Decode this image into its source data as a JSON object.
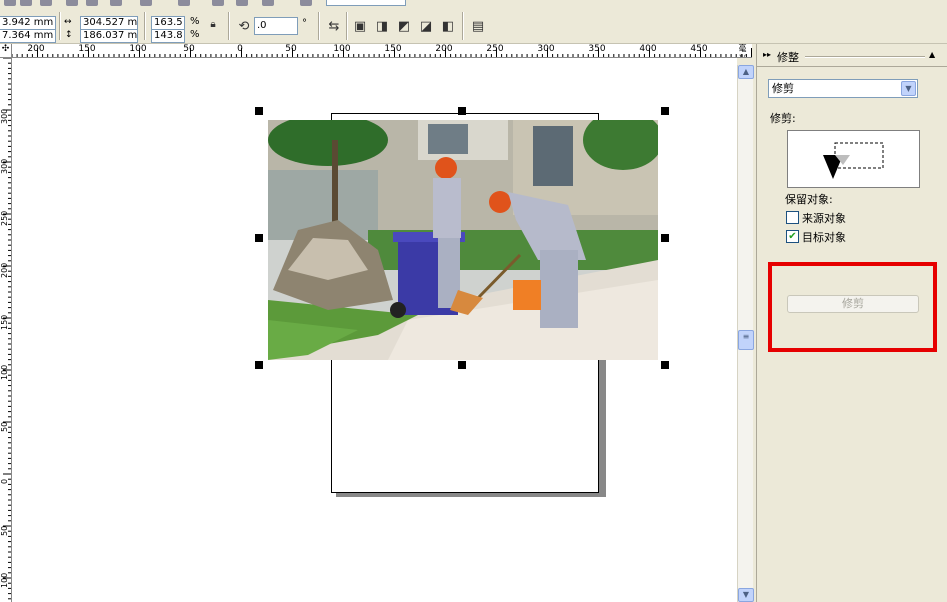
{
  "propertybar": {
    "pos_x": "3.942 mm",
    "pos_y": "7.364 mm",
    "width": "304.527 mr",
    "height": "186.037 mr",
    "scale_x": "163.5",
    "scale_y": "143.8",
    "percent_symbol": "%",
    "rotation": ".0",
    "degree_symbol": "°"
  },
  "ruler": {
    "unit": "毫米",
    "h_labels": [
      "200",
      "150",
      "100",
      "50",
      "0",
      "50",
      "100",
      "150",
      "200",
      "250",
      "300",
      "350",
      "400",
      "450"
    ],
    "v_labels": [
      "300",
      "300",
      "250",
      "200",
      "150",
      "100",
      "50",
      "0",
      "50",
      "100"
    ]
  },
  "docker": {
    "title": "修整",
    "mode_select": "修剪",
    "section_label": "修剪:",
    "keep_label": "保留对象:",
    "source_label": "来源对象",
    "source_checked": false,
    "target_label": "目标对象",
    "target_checked": true,
    "apply_label": "修剪"
  },
  "colors": {
    "highlight": "#e60000",
    "page_shadow": "#888888",
    "scrollbar_button": "#c1d3fb"
  },
  "photo": {
    "icon": "photo-image"
  }
}
